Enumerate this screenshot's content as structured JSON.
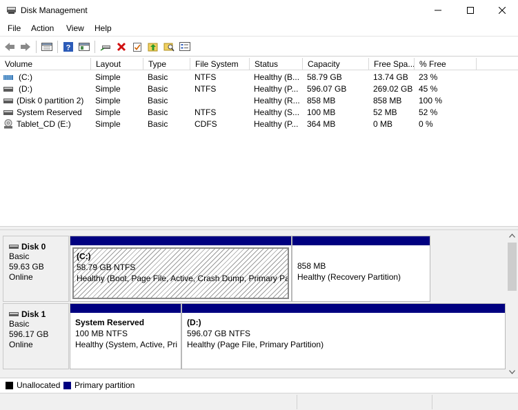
{
  "window": {
    "title": "Disk Management",
    "icon": "disk-management-icon",
    "controls": [
      "minimize-icon",
      "maximize-icon",
      "close-icon"
    ]
  },
  "menu": [
    "File",
    "Action",
    "View",
    "Help"
  ],
  "toolbar": [
    "back-arrow-icon",
    "forward-arrow-icon",
    "disk-list-icon",
    "help-icon",
    "console-icon",
    "connect-disk-icon",
    "delete-icon",
    "properties-check-icon",
    "folder-up-icon",
    "search-folder-icon",
    "properties-list-icon"
  ],
  "list": {
    "columns": [
      "Volume",
      "Layout",
      "Type",
      "File System",
      "Status",
      "Capacity",
      "Free Spa...",
      "% Free"
    ],
    "rows": [
      {
        "volume": "(C:)",
        "layout": "Simple",
        "type": "Basic",
        "fs": "NTFS",
        "status": "Healthy (B...",
        "capacity": "58.79 GB",
        "free": "13.74 GB",
        "pct": "23 %",
        "icon": "striped-volume-icon"
      },
      {
        "volume": "(D:)",
        "layout": "Simple",
        "type": "Basic",
        "fs": "NTFS",
        "status": "Healthy (P...",
        "capacity": "596.07 GB",
        "free": "269.02 GB",
        "pct": "45 %",
        "icon": "volume-icon"
      },
      {
        "volume": "(Disk 0 partition 2)",
        "layout": "Simple",
        "type": "Basic",
        "fs": "",
        "status": "Healthy (R...",
        "capacity": "858 MB",
        "free": "858 MB",
        "pct": "100 %",
        "icon": "volume-icon"
      },
      {
        "volume": "System Reserved",
        "layout": "Simple",
        "type": "Basic",
        "fs": "NTFS",
        "status": "Healthy (S...",
        "capacity": "100 MB",
        "free": "52 MB",
        "pct": "52 %",
        "icon": "volume-icon"
      },
      {
        "volume": "Tablet_CD (E:)",
        "layout": "Simple",
        "type": "Basic",
        "fs": "CDFS",
        "status": "Healthy (P...",
        "capacity": "364 MB",
        "free": "0 MB",
        "pct": "0 %",
        "icon": "cd-drive-icon"
      }
    ]
  },
  "disks": [
    {
      "name": "Disk 0",
      "type": "Basic",
      "size": "59.63 GB",
      "state": "Online",
      "partitions": [
        {
          "title": "(C:)",
          "size": "58.79 GB NTFS",
          "status": "Healthy (Boot, Page File, Active, Crash Dump, Primary Part"
        },
        {
          "title": "",
          "size": "858 MB",
          "status": "Healthy (Recovery Partition)"
        }
      ]
    },
    {
      "name": "Disk 1",
      "type": "Basic",
      "size": "596.17 GB",
      "state": "Online",
      "partitions": [
        {
          "title": "System Reserved",
          "size": "100 MB NTFS",
          "status": "Healthy (System, Active, Pri"
        },
        {
          "title": "(D:)",
          "size": "596.07 GB NTFS",
          "status": "Healthy (Page File, Primary Partition)"
        }
      ]
    }
  ],
  "legend": [
    {
      "label": "Unallocated",
      "color": "#000000"
    },
    {
      "label": "Primary partition",
      "color": "#000080"
    }
  ],
  "colors": {
    "primary_partition": "#000080",
    "unallocated": "#000000"
  }
}
